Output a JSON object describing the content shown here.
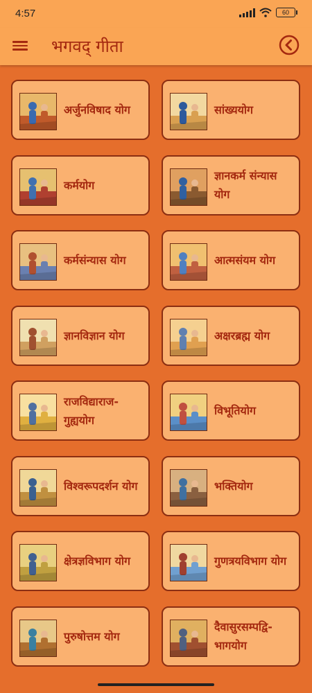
{
  "status": {
    "time": "4:57",
    "battery": "60"
  },
  "app_bar": {
    "title": "भगवद् गीता",
    "menu_icon": "menu-icon",
    "back_icon": "chevron-left-circle-icon"
  },
  "chapters": [
    {
      "label": "अर्जुनविषाद योग"
    },
    {
      "label": "सांख्ययोग"
    },
    {
      "label": "कर्मयोग"
    },
    {
      "label": "ज्ञानकर्म संन्यास योग"
    },
    {
      "label": "कर्मसंन्यास योग"
    },
    {
      "label": "आत्मसंयम योग"
    },
    {
      "label": "ज्ञानविज्ञान योग"
    },
    {
      "label": "अक्षरब्रह्म योग"
    },
    {
      "label": "राजविद्याराज-गुह्ययोग"
    },
    {
      "label": "विभूतियोग"
    },
    {
      "label": "विश्वरूपदर्शन योग"
    },
    {
      "label": "भक्तियोग"
    },
    {
      "label": "क्षेत्रज्ञविभाग योग"
    },
    {
      "label": "गुणत्रयविभाग योग"
    },
    {
      "label": "पुरुषोत्तम योग"
    },
    {
      "label": "दैवासुरसम्पद्वि-भागयोग"
    }
  ],
  "colors": {
    "accent": "#A4280F",
    "background": "#E56E2C",
    "card": "#FAB170",
    "bar": "#FAA554"
  }
}
